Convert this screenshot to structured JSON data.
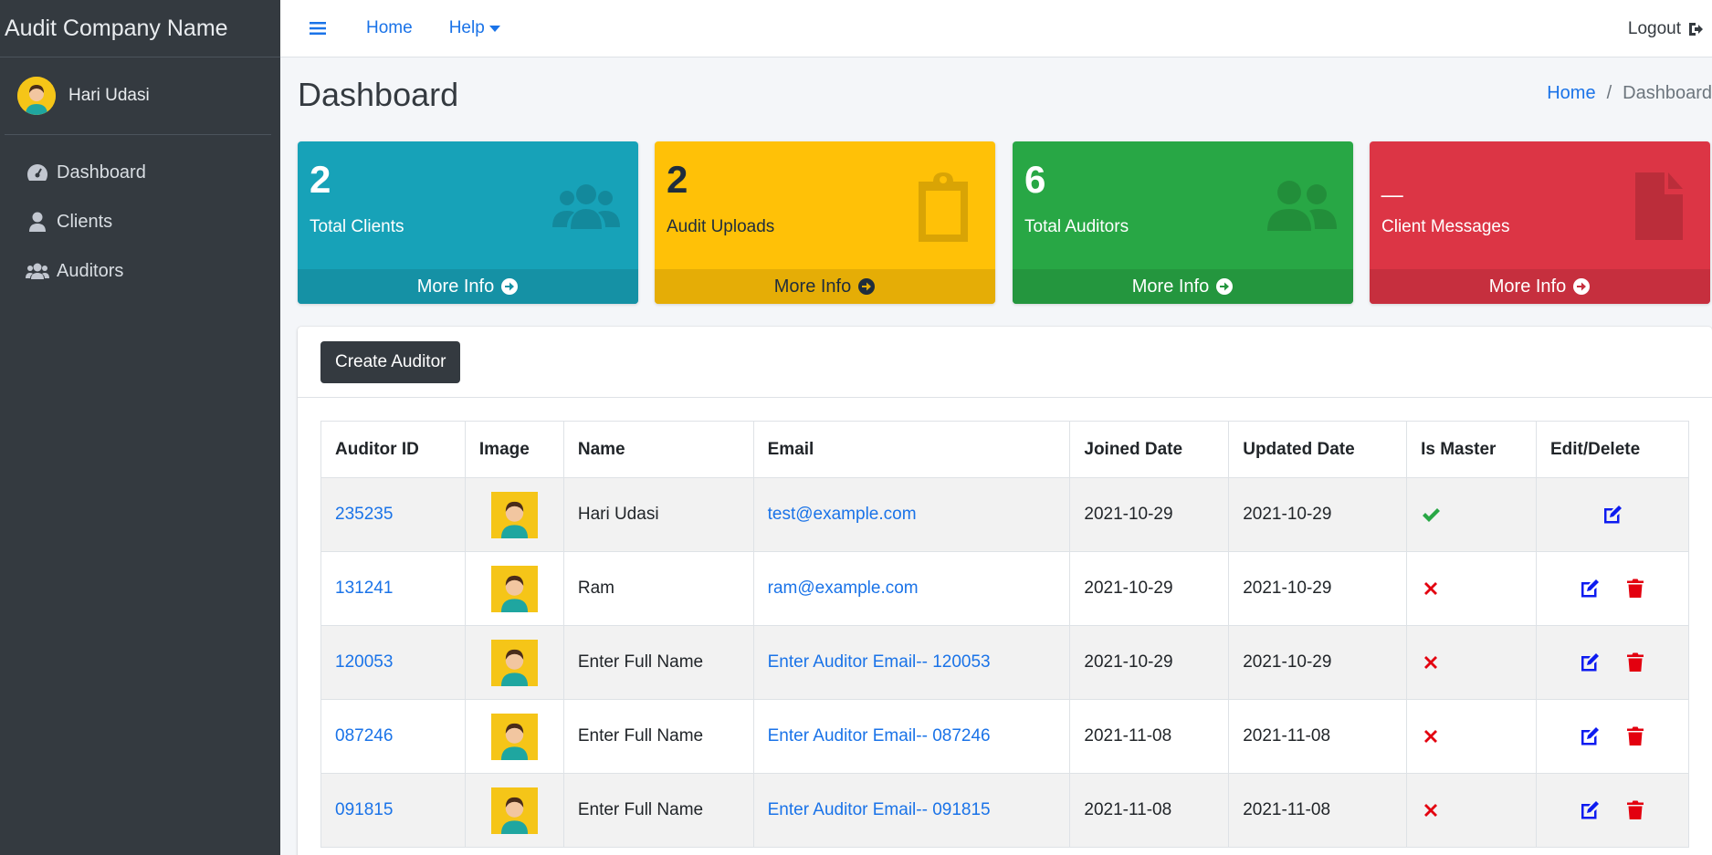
{
  "brand": {
    "title": "Audit Company Name"
  },
  "user": {
    "name": "Hari Udasi"
  },
  "sidebar": {
    "items": [
      {
        "label": "Dashboard",
        "icon": "tachometer-icon"
      },
      {
        "label": "Clients",
        "icon": "user-icon"
      },
      {
        "label": "Auditors",
        "icon": "users-icon"
      }
    ]
  },
  "topbar": {
    "home_label": "Home",
    "help_label": "Help",
    "logout_label": "Logout"
  },
  "page": {
    "title": "Dashboard"
  },
  "breadcrumb": {
    "home": "Home",
    "separator": "/",
    "current": "Dashboard"
  },
  "boxes": [
    {
      "value": "2",
      "label": "Total Clients",
      "footer": "More Info",
      "color": "#17a2b8",
      "icon": "users-icon"
    },
    {
      "value": "2",
      "label": "Audit Uploads",
      "footer": "More Info",
      "color": "#ffc107",
      "icon": "clipboard-icon"
    },
    {
      "value": "6",
      "label": "Total Auditors",
      "footer": "More Info",
      "color": "#28a745",
      "icon": "user-friends-icon"
    },
    {
      "value": "_",
      "label": "Client Messages",
      "footer": "More Info",
      "color": "#dc3545",
      "icon": "file-icon"
    }
  ],
  "card": {
    "create_button": "Create Auditor"
  },
  "table": {
    "headers": [
      "Auditor ID",
      "Image",
      "Name",
      "Email",
      "Joined Date",
      "Updated Date",
      "Is Master",
      "Edit/Delete"
    ],
    "rows": [
      {
        "id": "235235",
        "name": "Hari Udasi",
        "email": "test@example.com",
        "joined": "2021-10-29",
        "updated": "2021-10-29",
        "is_master": true
      },
      {
        "id": "131241",
        "name": "Ram",
        "email": "ram@example.com",
        "joined": "2021-10-29",
        "updated": "2021-10-29",
        "is_master": false
      },
      {
        "id": "120053",
        "name": "Enter Full Name",
        "email": "Enter Auditor Email-- 120053",
        "joined": "2021-10-29",
        "updated": "2021-10-29",
        "is_master": false
      },
      {
        "id": "087246",
        "name": "Enter Full Name",
        "email": "Enter Auditor Email-- 087246",
        "joined": "2021-11-08",
        "updated": "2021-11-08",
        "is_master": false
      },
      {
        "id": "091815",
        "name": "Enter Full Name",
        "email": "Enter Auditor Email-- 091815",
        "joined": "2021-11-08",
        "updated": "2021-11-08",
        "is_master": false
      }
    ]
  }
}
